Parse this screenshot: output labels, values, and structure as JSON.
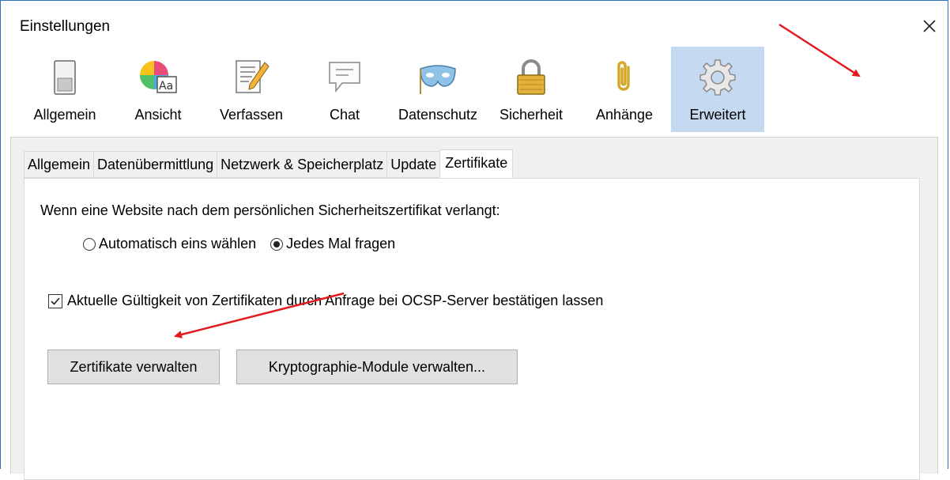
{
  "window": {
    "title": "Einstellungen",
    "close_label": "✕"
  },
  "toolbar": {
    "items": [
      {
        "label": "Allgemein",
        "icon": "switch-icon"
      },
      {
        "label": "Ansicht",
        "icon": "color-text-icon"
      },
      {
        "label": "Verfassen",
        "icon": "document-pencil-icon"
      },
      {
        "label": "Chat",
        "icon": "chat-bubble-icon"
      },
      {
        "label": "Datenschutz",
        "icon": "mask-icon"
      },
      {
        "label": "Sicherheit",
        "icon": "padlock-icon"
      },
      {
        "label": "Anhänge",
        "icon": "paperclip-icon"
      },
      {
        "label": "Erweitert",
        "icon": "gear-icon",
        "selected": true
      }
    ]
  },
  "tabs": {
    "items": [
      {
        "label": "Allgemein"
      },
      {
        "label": "Datenübermittlung"
      },
      {
        "label": "Netzwerk & Speicherplatz"
      },
      {
        "label": "Update"
      },
      {
        "label": "Zertifikate",
        "active": true
      }
    ]
  },
  "certs": {
    "description": "Wenn eine Website nach dem persönlichen Sicherheitszertifikat verlangt:",
    "radio_auto": {
      "label": "Automatisch eins wählen",
      "checked": false
    },
    "radio_ask": {
      "label": "Jedes Mal fragen",
      "checked": true
    },
    "ocsp": {
      "label": "Aktuelle Gültigkeit von Zertifikaten durch Anfrage bei OCSP-Server bestätigen lassen",
      "checked": true
    },
    "manage_button": "Zertifikate verwalten",
    "crypto_button": "Kryptographie-Module verwalten..."
  },
  "colors": {
    "selected_bg": "#c5d9f1",
    "arrow": "#e3191f",
    "window_border": "#2f6fbf"
  }
}
